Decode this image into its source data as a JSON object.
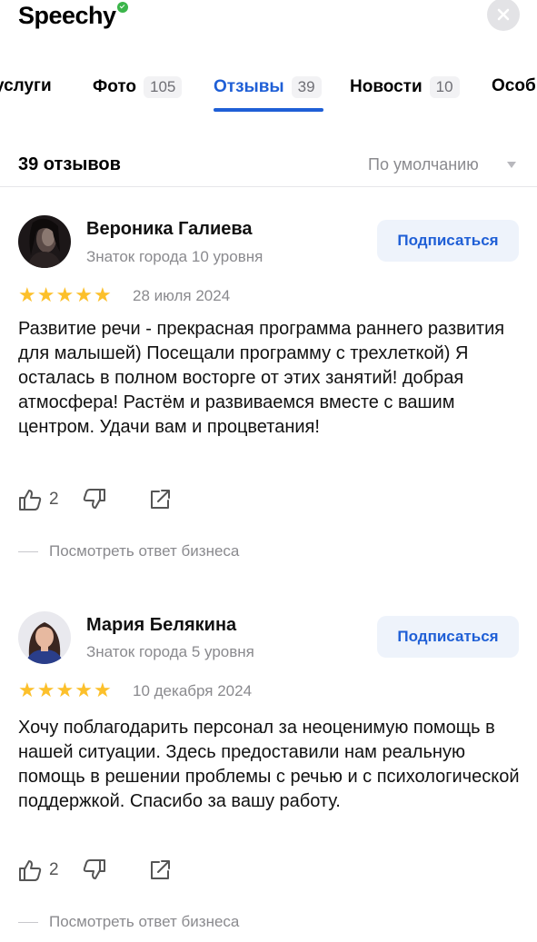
{
  "header": {
    "brand": "Speechy",
    "close_icon": "close-icon"
  },
  "tabs": [
    {
      "label": "услуги",
      "count": ""
    },
    {
      "label": "Фото",
      "count": "105"
    },
    {
      "label": "Отзывы",
      "count": "39",
      "active": true
    },
    {
      "label": "Новости",
      "count": "10"
    },
    {
      "label": "Особ",
      "count": ""
    }
  ],
  "reviews_header": {
    "title": "39 отзывов",
    "sort": "По умолчанию"
  },
  "reviews": [
    {
      "author": "Вероника Галиева",
      "level": "Знаток города 10 уровня",
      "subscribe": "Подписаться",
      "rating": 5,
      "date": "28 июля 2024",
      "text": "Развитие речи - прекрасная программа раннего развития для малышей)  Посещали программу с трехлеткой) Я осталась в полном восторге от этих занятий! добрая атмосфера! Растём и развиваемся вместе с вашим центром. Удачи вам и процветания!",
      "likes": "2",
      "reply": "Посмотреть ответ бизнеса"
    },
    {
      "author": "Мария Белякина",
      "level": "Знаток города 5 уровня",
      "subscribe": "Подписаться",
      "rating": 5,
      "date": "10 декабря 2024",
      "text": "Хочу поблагодарить персонал за неоценимую помощь в нашей ситуации. Здесь предоставили нам реальную помощь в решении проблемы с речью и с психологической поддержкой. Спасибо за вашу работу.",
      "likes": "2",
      "reply": "Посмотреть ответ бизнеса"
    }
  ],
  "colors": {
    "accent": "#1f5fd6",
    "star": "#fcc02b",
    "brand_dot": "#3bb54a"
  }
}
